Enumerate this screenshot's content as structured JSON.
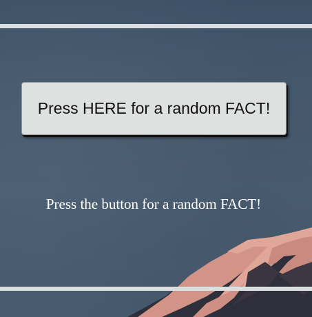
{
  "button": {
    "label": "Press HERE for a random FACT!"
  },
  "fact": {
    "text": "Press the button for a random FACT!"
  },
  "colors": {
    "background": "#46596d",
    "rule": "#dcdfe0",
    "button_bg": "#dfe1e1",
    "fact_text": "#ffffff",
    "mountain_lit": "#d89a8e",
    "mountain_shadow": "#2a2b35"
  }
}
